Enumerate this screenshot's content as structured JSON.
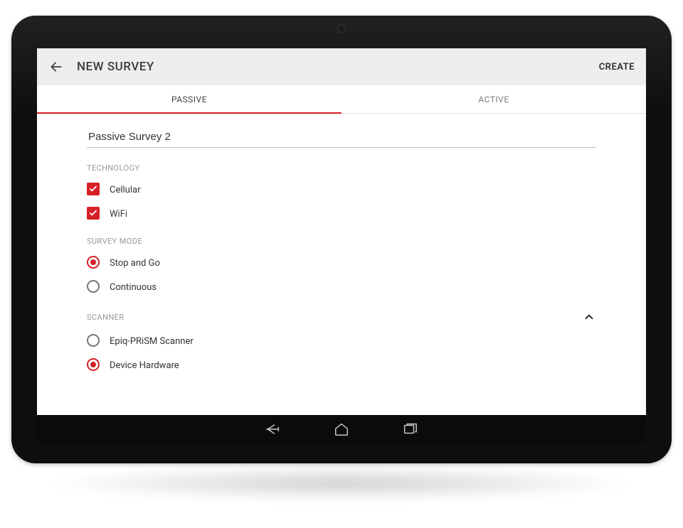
{
  "appbar": {
    "title": "NEW SURVEY",
    "action": "CREATE"
  },
  "tabs": {
    "passive": "PASSIVE",
    "active": "ACTIVE"
  },
  "form": {
    "name_value": "Passive Survey 2",
    "technology": {
      "label": "TECHNOLOGY",
      "cellular": "Cellular",
      "wifi": "WiFi"
    },
    "survey_mode": {
      "label": "SURVEY MODE",
      "stop_and_go": "Stop and Go",
      "continuous": "Continuous"
    },
    "scanner": {
      "label": "SCANNER",
      "epiq": "Epiq-PRiSM Scanner",
      "device": "Device Hardware"
    }
  }
}
